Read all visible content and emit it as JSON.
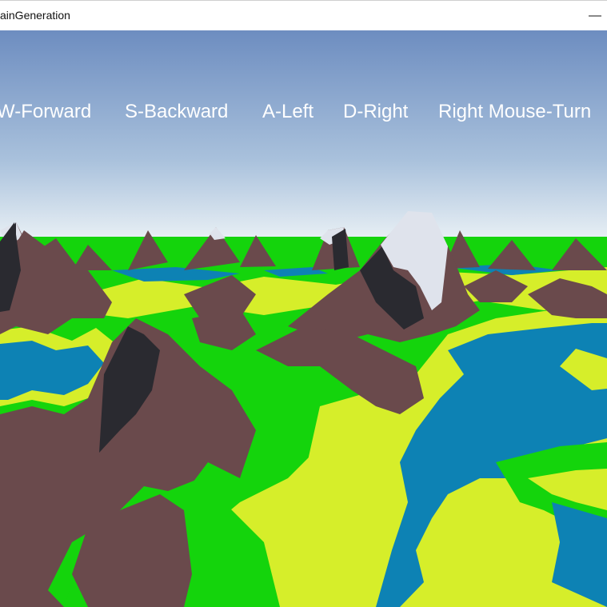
{
  "window": {
    "title": "ainGeneration",
    "minimize_glyph": "—"
  },
  "hud": {
    "controls": [
      {
        "label": "W-Forward"
      },
      {
        "label": "S-Backward"
      },
      {
        "label": "A-Left"
      },
      {
        "label": "D-Right"
      },
      {
        "label": "Right Mouse-Turn"
      }
    ]
  },
  "colors": {
    "sky_top": "#6f8fc2",
    "sky_horizon": "#eef4f7",
    "grass": "#14d40c",
    "sand": "#d6ee2a",
    "water": "#0d82b4",
    "rock": "#6a4a4c",
    "rock_shadow": "#2a2a30",
    "snow": "#dfe3ec"
  }
}
